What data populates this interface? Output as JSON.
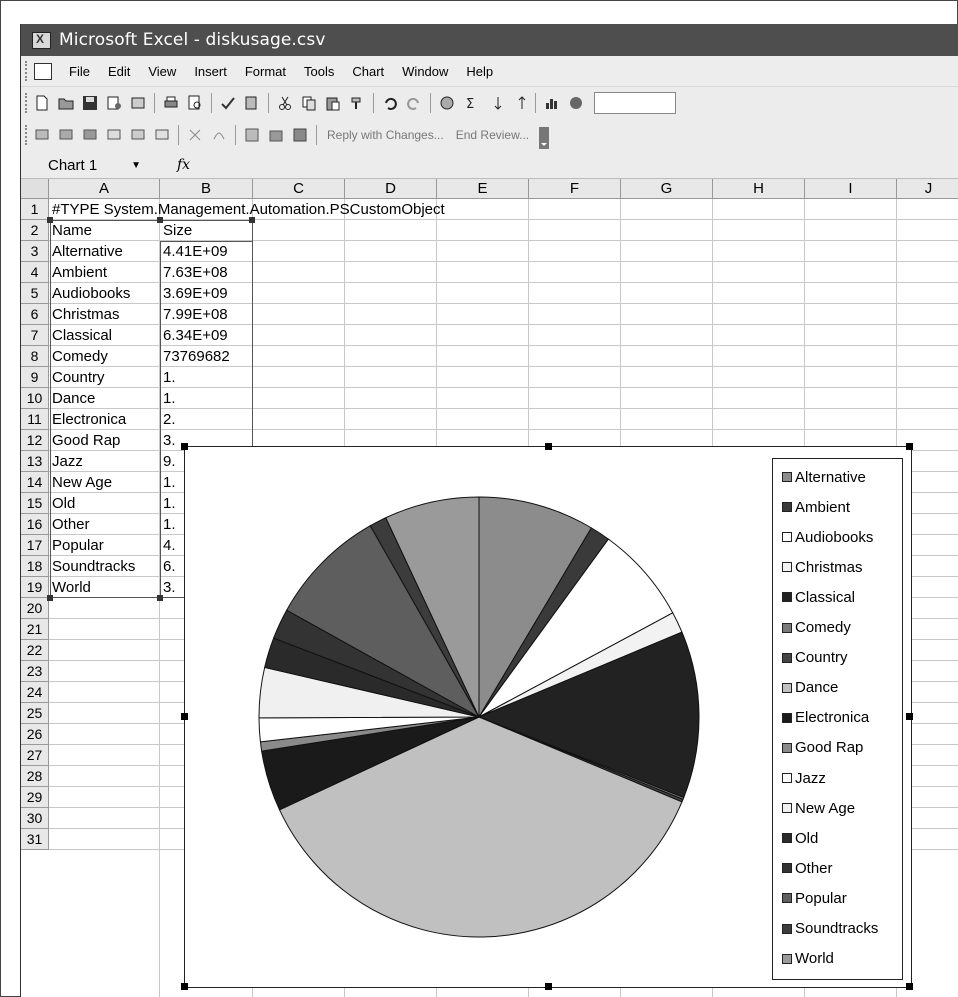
{
  "window": {
    "title": "Microsoft Excel - diskusage.csv"
  },
  "menu": [
    "File",
    "Edit",
    "View",
    "Insert",
    "Format",
    "Tools",
    "Chart",
    "Window",
    "Help"
  ],
  "toolbar2": {
    "reply_label": "Reply with Changes...",
    "end_review_label": "End Review..."
  },
  "formula": {
    "name_box": "Chart 1",
    "fx_symbol": "fx"
  },
  "columns": [
    "A",
    "B",
    "C",
    "D",
    "E",
    "F",
    "G",
    "H",
    "I",
    "J"
  ],
  "rows": [
    "1",
    "2",
    "3",
    "4",
    "5",
    "6",
    "7",
    "8",
    "9",
    "10",
    "11",
    "12",
    "13",
    "14",
    "15",
    "16",
    "17",
    "18",
    "19",
    "20",
    "21",
    "22",
    "23",
    "24",
    "25",
    "26",
    "27",
    "28",
    "29",
    "30",
    "31"
  ],
  "cells": {
    "a1": "#TYPE System.Management.Automation.PSCustomObject",
    "col_a": [
      "Name",
      "Alternative",
      "Ambient",
      "Audiobooks",
      "Christmas",
      "Classical",
      "Comedy",
      "Country",
      "Dance",
      "Electronica",
      "Good Rap",
      "Jazz",
      "New Age",
      "Old",
      "Other",
      "Popular",
      "Soundtracks",
      "World"
    ],
    "col_b": [
      "Size",
      "4.41E+09",
      "7.63E+08",
      "3.69E+09",
      "7.99E+08",
      "6.34E+09",
      "73769682",
      "1.",
      "1.",
      "2.",
      "3.",
      "9.",
      "1.",
      "1.",
      "1.",
      "4.",
      "6.",
      "3."
    ]
  },
  "chart_data": {
    "type": "pie",
    "title": "",
    "categories": [
      "Alternative",
      "Ambient",
      "Audiobooks",
      "Christmas",
      "Classical",
      "Comedy",
      "Country",
      "Dance",
      "Electronica",
      "Good Rap",
      "Jazz",
      "New Age",
      "Old",
      "Other",
      "Popular",
      "Soundtracks",
      "World"
    ],
    "values": [
      4410000000.0,
      763000000.0,
      3690000000.0,
      799000000.0,
      6340000000.0,
      73800000.0,
      100000000.0,
      19000000000.0,
      2300000000.0,
      350000000.0,
      900000000.0,
      1900000000.0,
      1150000000.0,
      1150000000.0,
      4500000000.0,
      650000000.0,
      3600000000.0
    ],
    "colors": [
      "#8c8c8c",
      "#3a3a3a",
      "#ffffff",
      "#f2f2f2",
      "#222222",
      "#7a7a7a",
      "#444444",
      "#c0c0c0",
      "#1a1a1a",
      "#8a8a8a",
      "#ffffff",
      "#f0f0f0",
      "#2a2a2a",
      "#333333",
      "#5e5e5e",
      "#3c3c3c",
      "#9a9a9a"
    ],
    "start_angle_deg": 0,
    "direction": "clockwise",
    "legend_position": "right",
    "legend": [
      "Alternative",
      "Ambient",
      "Audiobooks",
      "Christmas",
      "Classical",
      "Comedy",
      "Country",
      "Dance",
      "Electronica",
      "Good Rap",
      "Jazz",
      "New Age",
      "Old",
      "Other",
      "Popular",
      "Soundtracks",
      "World"
    ]
  }
}
